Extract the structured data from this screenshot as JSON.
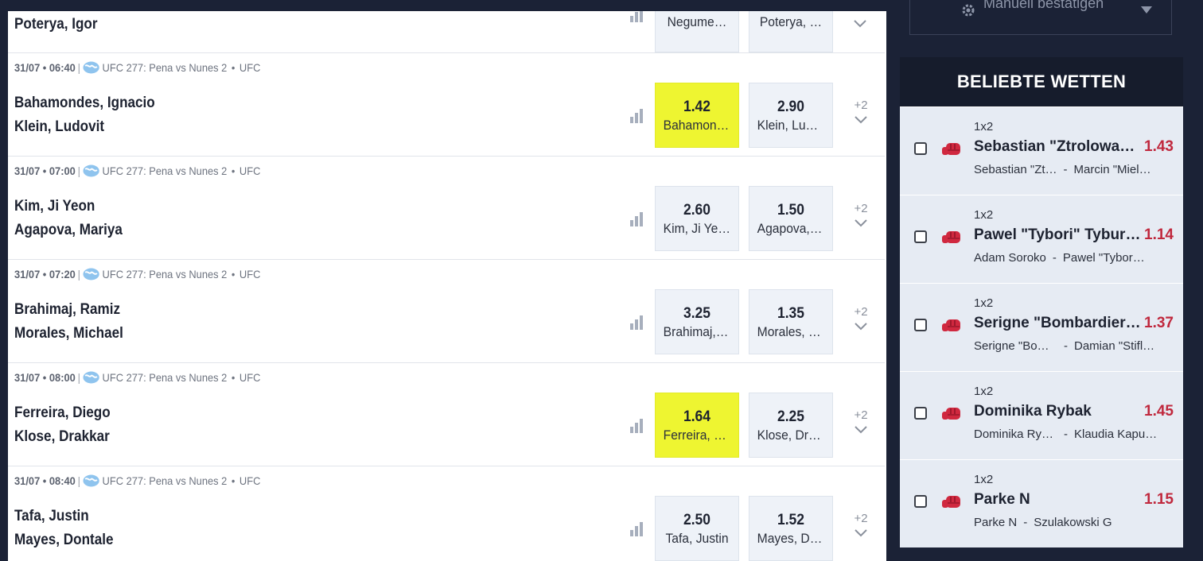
{
  "colors": {
    "background": "#1b2236",
    "selected_odd": "#eef531",
    "popular_odd": "#c0283d",
    "odd_box": "#eef2f8"
  },
  "partial_match": {
    "team1": "Poterya, Igor",
    "odd1_label": "Negume…",
    "odd2_label": "Poterya, …"
  },
  "matches": [
    {
      "date_time": "31/07 • 06:40",
      "event": "UFC 277: Pena vs Nunes 2",
      "league": "UFC",
      "team1": "Bahamondes, Ignacio",
      "team2": "Klein, Ludovit",
      "odd1": {
        "price": "1.42",
        "label": "Bahamondes, Ignacio",
        "selected": true
      },
      "odd2": {
        "price": "2.90",
        "label": "Klein, Ludovit",
        "selected": false
      },
      "more": "+2"
    },
    {
      "date_time": "31/07 • 07:00",
      "event": "UFC 277: Pena vs Nunes 2",
      "league": "UFC",
      "team1": "Kim, Ji Yeon",
      "team2": "Agapova, Mariya",
      "odd1": {
        "price": "2.60",
        "label": "Kim, Ji Yeon",
        "selected": false
      },
      "odd2": {
        "price": "1.50",
        "label": "Agapova, Mariya",
        "selected": false
      },
      "more": "+2"
    },
    {
      "date_time": "31/07 • 07:20",
      "event": "UFC 277: Pena vs Nunes 2",
      "league": "UFC",
      "team1": "Brahimaj, Ramiz",
      "team2": "Morales, Michael",
      "odd1": {
        "price": "3.25",
        "label": "Brahimaj, Ramiz",
        "selected": false
      },
      "odd2": {
        "price": "1.35",
        "label": "Morales, Michael",
        "selected": false
      },
      "more": "+2"
    },
    {
      "date_time": "31/07 • 08:00",
      "event": "UFC 277: Pena vs Nunes 2",
      "league": "UFC",
      "team1": "Ferreira, Diego",
      "team2": "Klose, Drakkar",
      "odd1": {
        "price": "1.64",
        "label": "Ferreira, Diego",
        "selected": true
      },
      "odd2": {
        "price": "2.25",
        "label": "Klose, Drakkar",
        "selected": false
      },
      "more": "+2"
    },
    {
      "date_time": "31/07 • 08:40",
      "event": "UFC 277: Pena vs Nunes 2",
      "league": "UFC",
      "team1": "Tafa, Justin",
      "team2": "Mayes, Dontale",
      "odd1": {
        "price": "2.50",
        "label": "Tafa, Justin",
        "selected": false
      },
      "odd2": {
        "price": "1.52",
        "label": "Mayes, Dontale",
        "selected": false
      },
      "more": "+2"
    }
  ],
  "confirm_button": {
    "label": "Manuell bestätigen",
    "icon": "gear-icon"
  },
  "popular": {
    "title": "BELIEBTE WETTEN",
    "items": [
      {
        "type": "1x2",
        "name": "Sebastian \"Ztrolowany\" …",
        "odd": "1.43",
        "home": "Sebastian \"Zt…",
        "away": "Marcin \"Mielo…"
      },
      {
        "type": "1x2",
        "name": "Pawel \"Tybori\" Tyburski",
        "odd": "1.14",
        "home": "Adam Soroko",
        "away": "Pawel \"Tybori…"
      },
      {
        "type": "1x2",
        "name": "Serigne \"Bombardier\" Ou…",
        "odd": "1.37",
        "home": "Serigne \"Bom…",
        "away": "Damian \"Stifl…"
      },
      {
        "type": "1x2",
        "name": "Dominika Rybak",
        "odd": "1.45",
        "home": "Dominika Ryb…",
        "away": "Klaudia Kapu…"
      },
      {
        "type": "1x2",
        "name": "Parke N",
        "odd": "1.15",
        "home": "Parke N",
        "away": "Szulakowski G"
      }
    ]
  }
}
